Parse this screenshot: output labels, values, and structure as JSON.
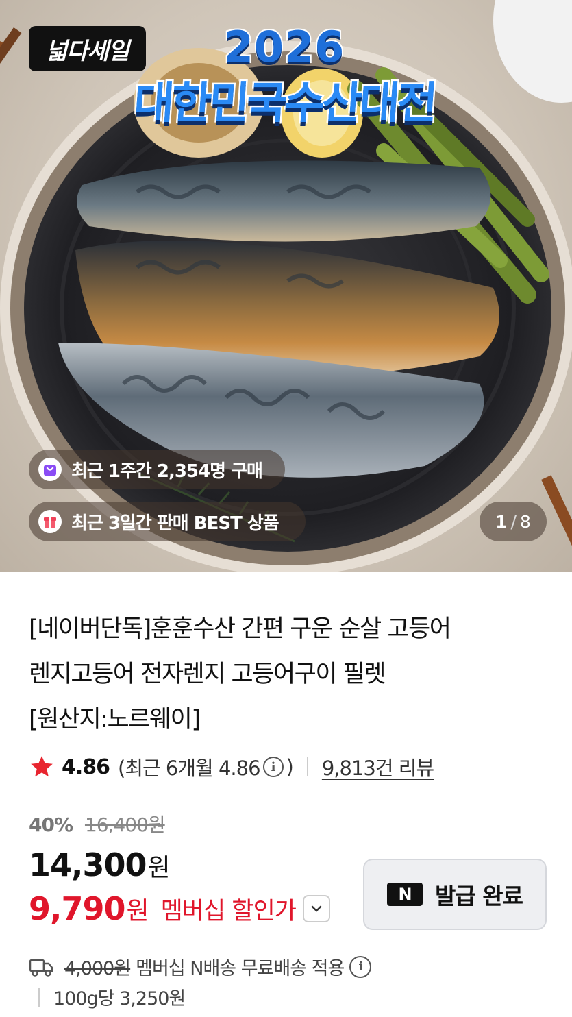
{
  "hero": {
    "sale_badge": "넓다세일",
    "festival_year": "2026",
    "festival_title": "대한민국수산대전",
    "chips": [
      {
        "icon": "shopping-bag-icon",
        "text": "최근 1주간 2,354명 구매"
      },
      {
        "icon": "gift-box-icon",
        "text": "최근 3일간 판매 BEST 상품"
      }
    ],
    "counter": {
      "current": "1",
      "separator": "/",
      "total": "8"
    }
  },
  "product": {
    "title_lines": [
      "[네이버단독]훈훈수산 간편 구운 순살 고등어",
      "렌지고등어 전자렌지 고등어구이 필렛",
      "[원산지:노르웨이]"
    ],
    "rating": {
      "score": "4.86",
      "recent_prefix": "(최근 6개월 4.86",
      "recent_suffix": ")",
      "reviews": "9,813건 리뷰"
    },
    "discount_rate": "40%",
    "original_price": "16,400원",
    "price": "14,300",
    "price_unit": "원",
    "member_price": "9,790",
    "member_price_unit": "원",
    "member_label": "멤버십 할인가",
    "coupon_button": "발급 완료",
    "coupon_logo": "N",
    "delivery": {
      "old_fee": "4,000원",
      "text": "멤버십 N배송 무료배송 적용"
    },
    "per_unit": "100g당 3,250원"
  },
  "colors": {
    "accent_red": "#e0162b",
    "star": "#e8252f"
  }
}
